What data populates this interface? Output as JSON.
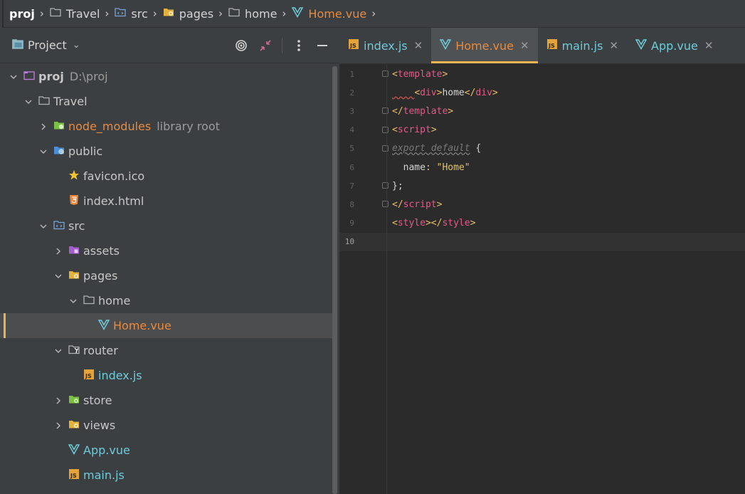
{
  "breadcrumb": [
    {
      "label": "proj",
      "icon": "none",
      "bold": true
    },
    {
      "label": "Travel",
      "icon": "folder-icon"
    },
    {
      "label": "src",
      "icon": "source-folder-icon"
    },
    {
      "label": "pages",
      "icon": "folder-yellow-icon"
    },
    {
      "label": "home",
      "icon": "folder-icon"
    },
    {
      "label": "Home.vue",
      "icon": "vue-icon",
      "vue": true
    }
  ],
  "project_panel": {
    "title": "Project",
    "actions": [
      "locate-icon",
      "collapse-icon",
      "more-icon",
      "hide-icon"
    ]
  },
  "tree": [
    {
      "label": "proj",
      "extra": "D:\\proj",
      "indent": 0,
      "arrow": "open",
      "icon": "project-icon"
    },
    {
      "label": "Travel",
      "indent": 1,
      "arrow": "open",
      "icon": "folder-icon"
    },
    {
      "label": "node_modules",
      "extra": "library root",
      "indent": 2,
      "arrow": "closed",
      "icon": "node-folder-icon",
      "style": "orange"
    },
    {
      "label": "public",
      "indent": 2,
      "arrow": "open",
      "icon": "web-folder-icon"
    },
    {
      "label": "favicon.ico",
      "indent": 3,
      "arrow": "none",
      "icon": "star-icon"
    },
    {
      "label": "index.html",
      "indent": 3,
      "arrow": "none",
      "icon": "html5-icon"
    },
    {
      "label": "src",
      "indent": 2,
      "arrow": "open",
      "icon": "source-folder-icon"
    },
    {
      "label": "assets",
      "indent": 3,
      "arrow": "closed",
      "icon": "assets-folder-icon"
    },
    {
      "label": "pages",
      "indent": 3,
      "arrow": "open",
      "icon": "folder-yellow-icon"
    },
    {
      "label": "home",
      "indent": 4,
      "arrow": "open",
      "icon": "folder-icon"
    },
    {
      "label": "Home.vue",
      "indent": 5,
      "arrow": "none",
      "icon": "vue-icon",
      "style": "orange",
      "selected": true
    },
    {
      "label": "router",
      "indent": 3,
      "arrow": "open",
      "icon": "router-folder-icon"
    },
    {
      "label": "index.js",
      "indent": 4,
      "arrow": "none",
      "icon": "js-icon",
      "style": "jsc"
    },
    {
      "label": "store",
      "indent": 3,
      "arrow": "closed",
      "icon": "store-folder-icon"
    },
    {
      "label": "views",
      "indent": 3,
      "arrow": "closed",
      "icon": "folder-yellow-icon"
    },
    {
      "label": "App.vue",
      "indent": 3,
      "arrow": "none",
      "icon": "vue-icon",
      "style": "vuec"
    },
    {
      "label": "main.js",
      "indent": 3,
      "arrow": "none",
      "icon": "js-icon",
      "style": "jsc"
    }
  ],
  "tabs": [
    {
      "label": "index.js",
      "icon": "js-icon",
      "color": "#6fcbd8"
    },
    {
      "label": "Home.vue",
      "icon": "vue-icon",
      "color": "#e98a3f",
      "active": true
    },
    {
      "label": "main.js",
      "icon": "js-icon",
      "color": "#6fcbd8"
    },
    {
      "label": "App.vue",
      "icon": "vue-icon",
      "color": "#6fcbd8"
    }
  ],
  "code_lines": [
    {
      "n": "1",
      "fold": true,
      "tokens": [
        [
          "tag",
          "<"
        ],
        [
          "tg",
          "template"
        ],
        [
          "tag",
          ">"
        ]
      ]
    },
    {
      "n": "2",
      "squiggle": true,
      "tokens": [
        [
          "tag",
          "<"
        ],
        [
          "tg",
          "div"
        ],
        [
          "tag",
          ">"
        ],
        [
          "plain",
          "home"
        ],
        [
          "tag",
          "</"
        ],
        [
          "tg",
          "div"
        ],
        [
          "tag",
          ">"
        ]
      ]
    },
    {
      "n": "3",
      "fold": true,
      "tokens": [
        [
          "tag",
          "</"
        ],
        [
          "tg",
          "template"
        ],
        [
          "tag",
          ">"
        ]
      ]
    },
    {
      "n": "4",
      "fold": true,
      "tokens": [
        [
          "tag",
          "<"
        ],
        [
          "tg",
          "script"
        ],
        [
          "tag",
          ">"
        ]
      ]
    },
    {
      "n": "5",
      "fold": true,
      "tokens": [
        [
          "kw",
          "export default"
        ],
        [
          "plain",
          " {"
        ]
      ]
    },
    {
      "n": "6",
      "tokens": [
        [
          "prop",
          "  name"
        ],
        [
          "tag",
          ": "
        ],
        [
          "str",
          "\"Home\""
        ]
      ]
    },
    {
      "n": "7",
      "fold": true,
      "tokens": [
        [
          "plain",
          "};"
        ]
      ]
    },
    {
      "n": "8",
      "fold": true,
      "tokens": [
        [
          "tag",
          "</"
        ],
        [
          "tg",
          "script"
        ],
        [
          "tag",
          ">"
        ]
      ]
    },
    {
      "n": "9",
      "tokens": [
        [
          "tag",
          "<"
        ],
        [
          "tg",
          "style"
        ],
        [
          "tag",
          "></"
        ],
        [
          "tg",
          "style"
        ],
        [
          "tag",
          ">"
        ]
      ]
    },
    {
      "n": "10",
      "current": true,
      "tokens": []
    }
  ]
}
